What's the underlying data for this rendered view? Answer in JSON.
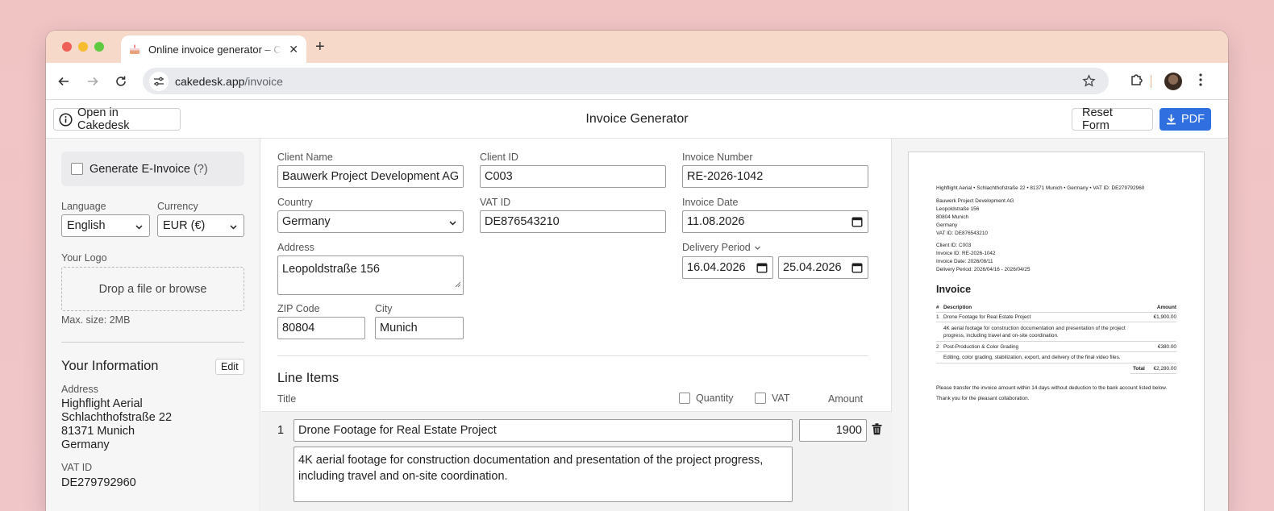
{
  "browser": {
    "tab_title": "Online invoice generator – Cakedesk",
    "url_host": "cakedesk.app",
    "url_path": "/invoice",
    "new_tab_glyph": "+",
    "close_glyph": "✕"
  },
  "appbar": {
    "open_label": "Open in Cakedesk",
    "title": "Invoice Generator",
    "reset_label": "Reset Form",
    "pdf_label": "PDF",
    "accent_color": "#2f6fe0"
  },
  "sidebar": {
    "einvoice_label": "Generate E-Invoice",
    "einvoice_help": "(?)",
    "language_label": "Language",
    "language_value": "English",
    "currency_label": "Currency",
    "currency_value": "EUR (€)",
    "logo_label": "Your Logo",
    "dropzone_text": "Drop a file or browse",
    "max_size": "Max. size: 2MB",
    "your_info_title": "Your Information",
    "edit_label": "Edit",
    "address_label": "Address",
    "address_lines": [
      "Highflight Aerial",
      "Schlachthofstraße 22",
      "81371 Munich",
      "Germany"
    ],
    "vat_label": "VAT ID",
    "vat_value": "DE279792960"
  },
  "form": {
    "client_name_label": "Client Name",
    "client_name": "Bauwerk Project Development AG",
    "client_id_label": "Client ID",
    "client_id": "C003",
    "invoice_number_label": "Invoice Number",
    "invoice_number": "RE-2026-1042",
    "country_label": "Country",
    "country": "Germany",
    "vat_id_label": "VAT ID",
    "vat_id": "DE876543210",
    "invoice_date_label": "Invoice Date",
    "invoice_date": "11.08.2026",
    "address_label": "Address",
    "address": "Leopoldstraße 156",
    "delivery_period_label": "Delivery Period",
    "delivery_from": "16.04.2026",
    "delivery_to": "25.04.2026",
    "zip_label": "ZIP Code",
    "zip": "80804",
    "city_label": "City",
    "city": "Munich"
  },
  "line_items": {
    "section_title": "Line Items",
    "col_title": "Title",
    "col_quantity": "Quantity",
    "col_vat": "VAT",
    "col_amount": "Amount",
    "items": [
      {
        "number": "1",
        "title": "Drone Footage for Real Estate Project",
        "amount": "1900",
        "description_line1": "4K aerial footage for construction documentation and presentation of the project progress,",
        "description_line2": "including travel and on-site coordination."
      }
    ]
  },
  "preview": {
    "sender_line": "Highflight Aerial • Schlachthofstraße 22 • 81371 Munich • Germany • VAT ID: DE279792960",
    "recipient_lines": [
      "Bauwerk Project Development AG",
      "Leopoldstraße 156",
      "80804 Munich",
      "Germany",
      "VAT ID: DE876543210"
    ],
    "meta_lines": [
      "Client ID: C003",
      "Invoice ID: RE-2026-1042",
      "Invoice Date: 2026/08/11",
      "Delivery Period: 2026/04/16 - 2026/04/25"
    ],
    "title": "Invoice",
    "table_header": {
      "num": "#",
      "desc": "Description",
      "amount": "Amount"
    },
    "rows": [
      {
        "num": "1",
        "title": "Drone Footage for Real Estate Project",
        "amount": "€1,900.00",
        "desc1": "4K aerial footage for construction documentation and presentation of the project",
        "desc2": "progress, including travel and on-site coordination."
      },
      {
        "num": "2",
        "title": "Post-Production & Color Grading",
        "amount": "€380.00",
        "desc1": "Editing, color grading, stabilization, export, and delivery of the final video files.",
        "desc2": ""
      }
    ],
    "total_label": "Total",
    "total_value": "€2,280.00",
    "footer1": "Please transfer the invoice amount within 14 days without deduction to the bank account listed below.",
    "footer2": "Thank you for the pleasant collaboration."
  }
}
